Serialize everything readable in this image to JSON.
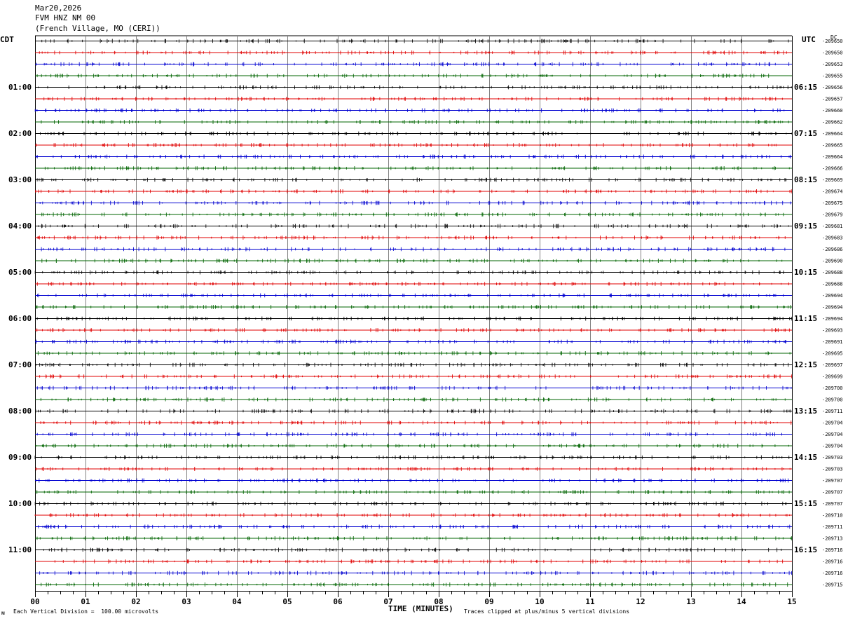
{
  "header": {
    "date": "Mar20,2026",
    "station": "FVM HNZ NM 00",
    "location": "(French Village, MO (CERI))"
  },
  "left_axis_label": "CDT",
  "right_axis_label": "UTC",
  "dc_label": "DC",
  "footer": {
    "scale_note": "Each Vertical Division =  100.00 microvolts",
    "clip_note": "Traces clipped at plus/minus 5 vertical divisions",
    "corner_mark": "ᴍ"
  },
  "colors": {
    "trace_cycle": [
      "#000000",
      "#e00000",
      "#0000d0",
      "#006400"
    ],
    "grid": "#808080"
  },
  "chart_data": {
    "type": "line",
    "title": "",
    "xlabel": "TIME (MINUTES)",
    "xlim": [
      0,
      15
    ],
    "x_tick_labels": [
      "00",
      "01",
      "02",
      "03",
      "04",
      "05",
      "06",
      "07",
      "08",
      "09",
      "10",
      "11",
      "12",
      "13",
      "14",
      "15"
    ],
    "left_hour_labels": [
      "01:00",
      "02:00",
      "03:00",
      "04:00",
      "05:00",
      "06:00",
      "07:00",
      "08:00",
      "09:00",
      "10:00",
      "11:00"
    ],
    "right_hour_labels": [
      "06:15",
      "07:15",
      "08:15",
      "09:15",
      "10:15",
      "11:15",
      "12:15",
      "13:15",
      "14:15",
      "15:15",
      "16:15"
    ],
    "trace_dc_offsets": [
      "-209650",
      "-209650",
      "-209653",
      "-209655",
      "-209656",
      "-209657",
      "-209660",
      "-209662",
      "-209664",
      "-209665",
      "-209664",
      "-209666",
      "-209669",
      "-209674",
      "-209675",
      "-209679",
      "-209681",
      "-209683",
      "-209686",
      "-209690",
      "-209688",
      "-209688",
      "-209694",
      "-209694",
      "-209694",
      "-209693",
      "-209691",
      "-209695",
      "-209697",
      "-209699",
      "-209700",
      "-209700",
      "-209711",
      "-209704",
      "-209704",
      "-209704",
      "-209703",
      "-209703",
      "-209707",
      "-209707",
      "-209707",
      "-209710",
      "-209711",
      "-209713",
      "-209716",
      "-209716",
      "-209716",
      "-209715"
    ]
  }
}
